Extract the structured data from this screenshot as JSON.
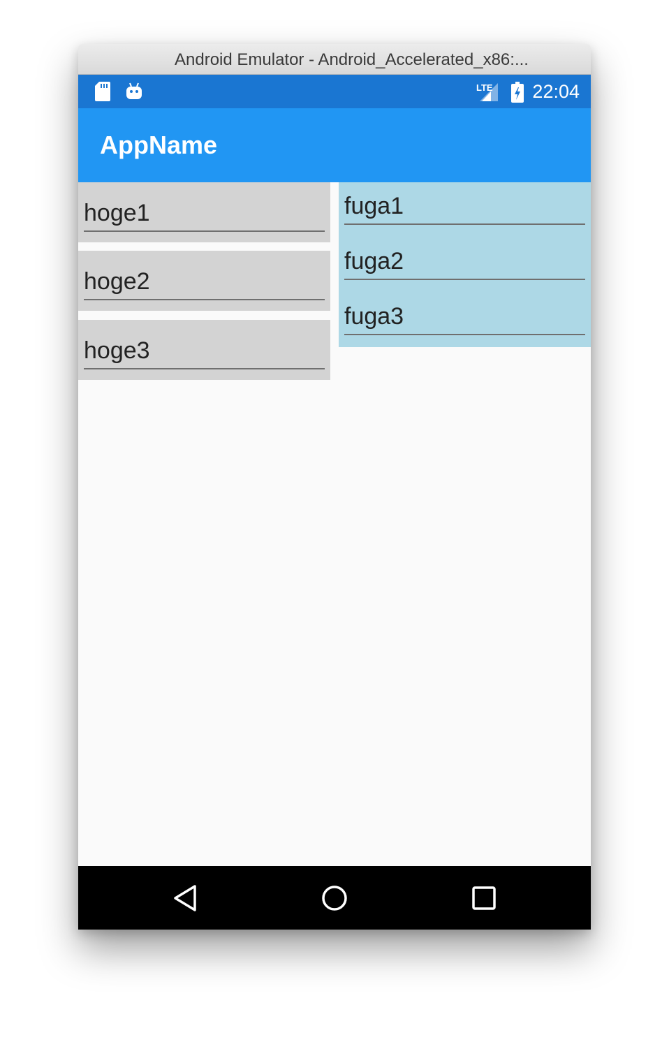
{
  "window": {
    "title": "Android Emulator - Android_Accelerated_x86:..."
  },
  "status_bar": {
    "time": "22:04",
    "network_label": "LTE",
    "icons": [
      "sd-card-icon",
      "android-debug-icon",
      "lte-signal-icon",
      "battery-charging-icon"
    ]
  },
  "app_bar": {
    "title": "AppName"
  },
  "left_entries": [
    {
      "value": "hoge1"
    },
    {
      "value": "hoge2"
    },
    {
      "value": "hoge3"
    }
  ],
  "right_entries": [
    {
      "value": "fuga1"
    },
    {
      "value": "fuga2"
    },
    {
      "value": "fuga3"
    }
  ],
  "nav_bar": {
    "buttons": [
      "back-icon",
      "home-icon",
      "recents-icon"
    ]
  },
  "colors": {
    "status_bar": "#1a76d2",
    "app_bar": "#2196f3",
    "left_entry_background": "#d3d3d3",
    "right_panel_background": "#add8e6",
    "page_background": "#fafafa",
    "nav_bar": "#000000"
  }
}
